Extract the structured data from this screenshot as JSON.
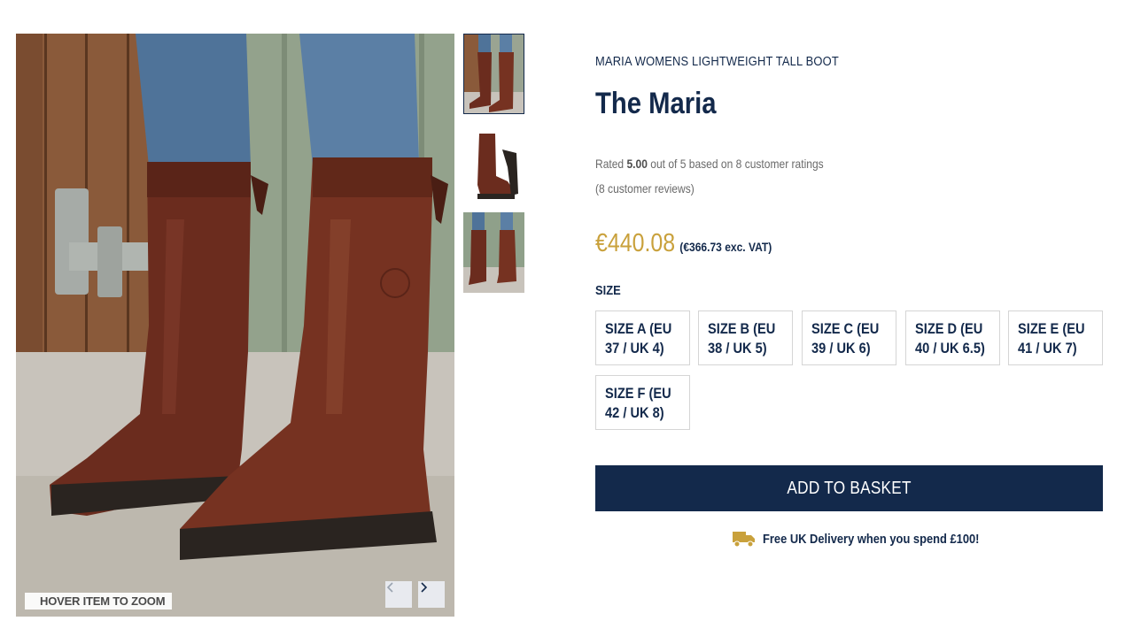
{
  "gallery": {
    "zoom_hint": "HOVER ITEM TO ZOOM",
    "prev_icon": "chevron-left-icon",
    "next_icon": "chevron-right-icon",
    "thumbnails": [
      "front view on wearer",
      "side view single boot",
      "back view on wearer"
    ],
    "active_thumbnail": 0
  },
  "product": {
    "brand_line": "MARIA WOMENS LIGHTWEIGHT TALL BOOT",
    "title": "The Maria",
    "rating_prefix": "Rated ",
    "rating_value": "5.00",
    "rating_suffix": " out of 5 based on 8 customer ratings",
    "reviews_link": "(8 customer reviews)",
    "price": "€440.08",
    "price_ex_vat": "(€366.73 exc. VAT)"
  },
  "size": {
    "label": "SIZE",
    "options": [
      "SIZE A (EU 37 / UK 4)",
      "SIZE B (EU 38 / UK 5)",
      "SIZE C (EU 39 / UK 6)",
      "SIZE D (EU 40 / UK 6.5)",
      "SIZE E (EU 41 / UK 7)",
      "SIZE F (EU 42 / UK 8)"
    ]
  },
  "actions": {
    "add_to_basket": "ADD TO BASKET"
  },
  "delivery": {
    "icon": "truck-icon",
    "text": "Free UK Delivery when you spend £100!"
  },
  "colors": {
    "navy": "#13294b",
    "gold": "#c9a13c",
    "border": "#d5d5d5"
  }
}
